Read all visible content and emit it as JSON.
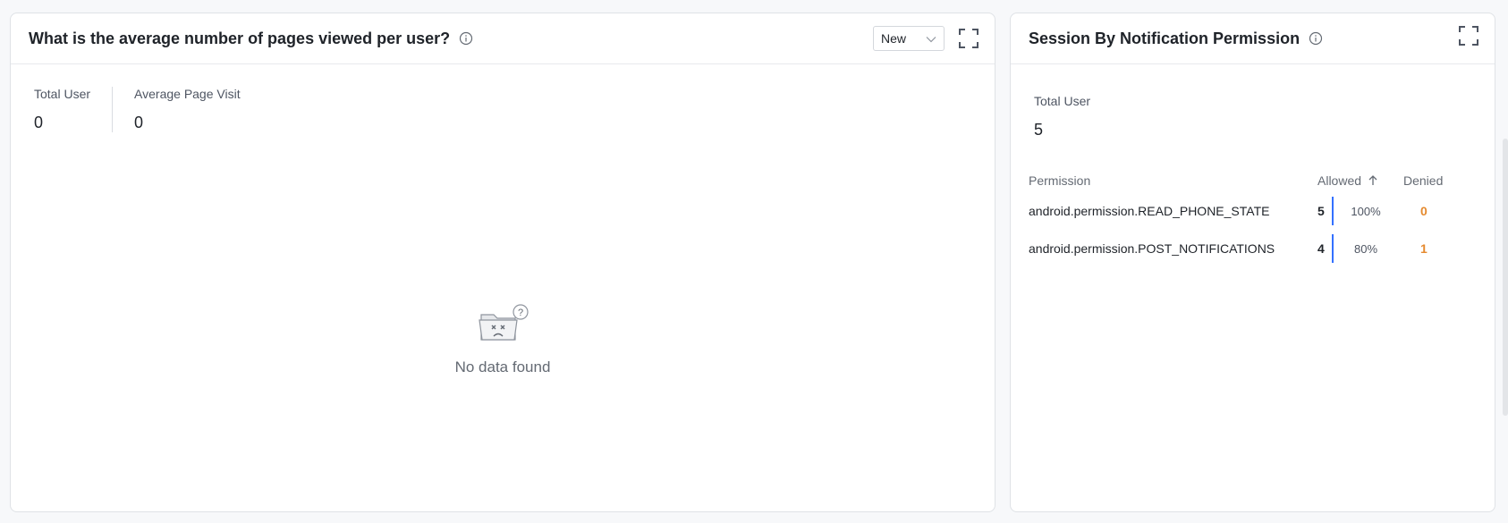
{
  "left_card": {
    "title": "What is the average number of pages viewed per user?",
    "select_value": "New",
    "stats": [
      {
        "label": "Total User",
        "value": "0"
      },
      {
        "label": "Average Page Visit",
        "value": "0"
      }
    ],
    "empty_text": "No data found"
  },
  "right_card": {
    "title": "Session By Notification Permission",
    "total_label": "Total User",
    "total_value": "5",
    "table": {
      "headers": {
        "permission": "Permission",
        "allowed": "Allowed",
        "denied": "Denied"
      },
      "rows": [
        {
          "permission": "android.permission.READ_PHONE_STATE",
          "allowed": "5",
          "allowed_pct": "100%",
          "denied": "0"
        },
        {
          "permission": "android.permission.POST_NOTIFICATIONS",
          "allowed": "4",
          "allowed_pct": "80%",
          "denied": "1"
        }
      ]
    }
  },
  "colors": {
    "accent": "#3370ff",
    "denied": "#e58a2f",
    "border": "#dfe2e6"
  },
  "icons": [
    "info-icon",
    "chevron-down-icon",
    "expand-icon",
    "sort-up-icon",
    "empty-folder-icon"
  ]
}
